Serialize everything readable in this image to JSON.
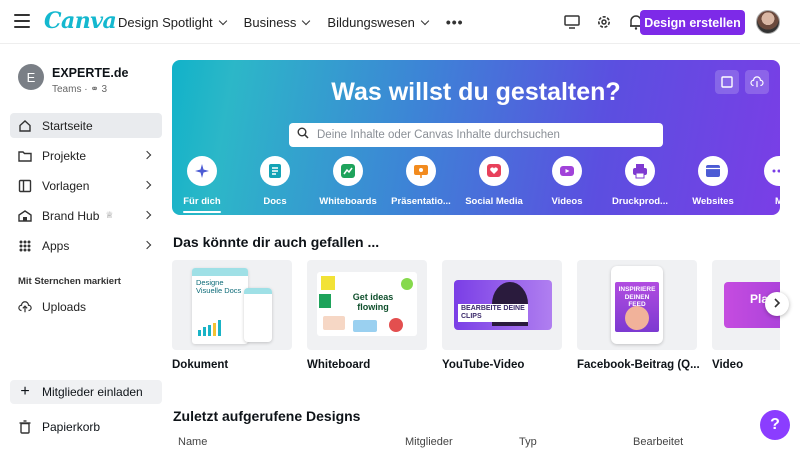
{
  "topbar": {
    "logo": "Canva",
    "nav": [
      "Design Spotlight",
      "Business",
      "Bildungswesen"
    ],
    "more": "•••",
    "create_button": "Design erstellen"
  },
  "sidebar": {
    "team_initial": "E",
    "team_name": "EXPERTE.de",
    "team_type": "Teams",
    "team_members": "3",
    "items": [
      {
        "label": "Startseite",
        "icon": "home-icon",
        "active": true
      },
      {
        "label": "Projekte",
        "icon": "folder-icon"
      },
      {
        "label": "Vorlagen",
        "icon": "template-icon"
      },
      {
        "label": "Brand Hub",
        "icon": "brand-icon"
      },
      {
        "label": "Apps",
        "icon": "apps-icon"
      }
    ],
    "starred_section": "Mit Sternchen markiert",
    "uploads": "Uploads",
    "invite": "Mitglieder einladen",
    "trash": "Papierkorb"
  },
  "hero": {
    "title": "Was willst du gestalten?",
    "search_placeholder": "Deine Inhalte oder Canvas Inhalte durchsuchen",
    "categories": [
      {
        "label": "Für dich",
        "color": "#4c5bd4"
      },
      {
        "label": "Docs",
        "color": "#13a3b5"
      },
      {
        "label": "Whiteboards",
        "color": "#1ea35b"
      },
      {
        "label": "Präsentatio...",
        "color": "#f28b1e"
      },
      {
        "label": "Social Media",
        "color": "#e8415b"
      },
      {
        "label": "Videos",
        "color": "#a143d9"
      },
      {
        "label": "Druckprod...",
        "color": "#7f3ad1"
      },
      {
        "label": "Websites",
        "color": "#4c5bd4"
      },
      {
        "label": "M",
        "color": "#7a3ee6"
      }
    ]
  },
  "recommendations": {
    "title": "Das könnte dir auch gefallen ...",
    "cards": [
      {
        "label": "Dokument",
        "doc_title": "Designe Visuelle Docs"
      },
      {
        "label": "Whiteboard",
        "board_title": "Get ideas flowing"
      },
      {
        "label": "YouTube-Video",
        "clip_title": "BEARBEITE DEINE CLIPS"
      },
      {
        "label": "Facebook-Beitrag (Q...",
        "feed_title": "INSPIRIERE DEINEN FEED"
      },
      {
        "label": "Video",
        "video_title": "Pla"
      }
    ]
  },
  "recent": {
    "title": "Zuletzt aufgerufene Designs",
    "columns": [
      "Name",
      "Mitglieder",
      "Typ",
      "Bearbeitet"
    ]
  },
  "help": "?"
}
